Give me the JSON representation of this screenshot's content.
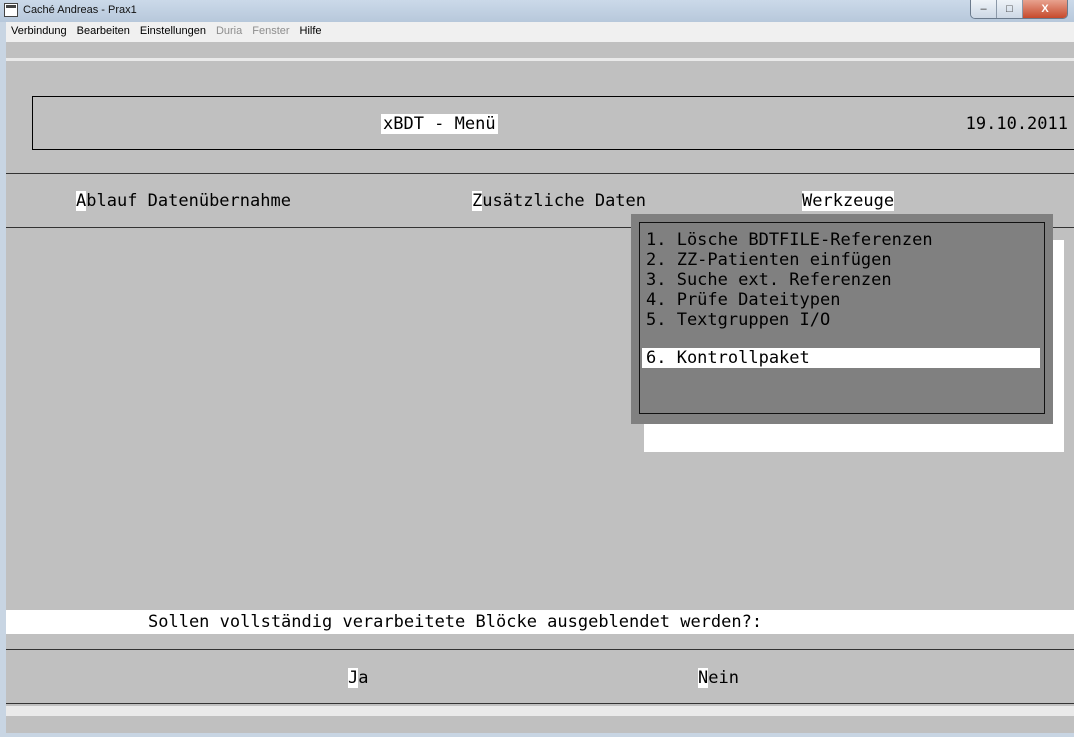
{
  "window": {
    "title": "Caché Andreas - Prax1",
    "buttons": [
      "–",
      "□",
      "X"
    ]
  },
  "menubar": {
    "items": [
      "Verbindung",
      "Bearbeiten",
      "Einstellungen",
      "Duria",
      "Fenster",
      "Hilfe"
    ]
  },
  "header": {
    "title": "xBDT - Menü",
    "date": "19.10.2011"
  },
  "main_menu": [
    {
      "hotkey": "A",
      "rest": "blauf Datenübernahme"
    },
    {
      "hotkey": "Z",
      "rest": "usätzliche Daten"
    },
    {
      "label": "Werkzeuge",
      "selected": true
    }
  ],
  "popup": {
    "items": [
      "1. Lösche BDTFILE-Referenzen",
      "2. ZZ-Patienten einfügen",
      "3. Suche ext. Referenzen",
      "4. Prüfe Dateitypen",
      "5. Textgruppen I/O",
      "6. Kontrollpaket"
    ],
    "selected_index": 5
  },
  "prompt": {
    "question": "Sollen vollständig verarbeitete Blöcke ausgeblendet werden?:"
  },
  "answers": [
    {
      "hotkey": "J",
      "rest": "a"
    },
    {
      "hotkey": "N",
      "rest": "ein"
    }
  ],
  "colors": {
    "terminal_bg": "#c0c0c0",
    "highlight": "#ffffff",
    "popup_bg": "#808080"
  }
}
